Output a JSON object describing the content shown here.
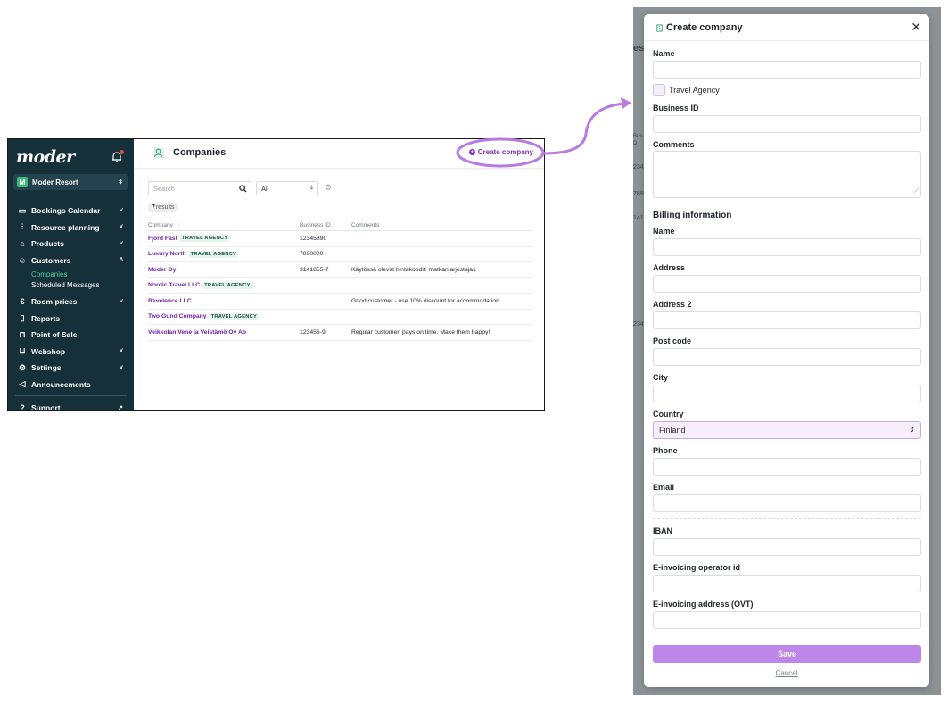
{
  "app": {
    "logo": "moder",
    "resort": {
      "initial": "M",
      "name": "Moder Resort"
    },
    "nav": [
      {
        "label": "Bookings Calendar",
        "icon": "calendar-icon",
        "chevron": "˅"
      },
      {
        "label": "Resource planning",
        "icon": "sliders-icon",
        "chevron": "˅"
      },
      {
        "label": "Products",
        "icon": "home-icon",
        "chevron": "˅"
      },
      {
        "label": "Customers",
        "icon": "users-icon",
        "chevron": "˄"
      },
      {
        "label": "Room prices",
        "icon": "euro-icon",
        "chevron": "˅"
      },
      {
        "label": "Reports",
        "icon": "report-icon",
        "chevron": ""
      },
      {
        "label": "Point of Sale",
        "icon": "bag-icon",
        "chevron": ""
      },
      {
        "label": "Webshop",
        "icon": "cart-icon",
        "chevron": "˅"
      },
      {
        "label": "Settings",
        "icon": "gear-icon",
        "chevron": "˅"
      },
      {
        "label": "Announcements",
        "icon": "megaphone-icon",
        "chevron": ""
      },
      {
        "label": "Support",
        "icon": "help-icon",
        "chevron": ""
      }
    ],
    "customers_sub": [
      "Companies",
      "Scheduled Messages"
    ],
    "page_title": "Companies",
    "create_label": "Create company",
    "search_placeholder": "Search",
    "filter_value": "All",
    "results_count": "7",
    "results_label": "results",
    "table": {
      "headers": [
        "Company",
        "Business ID",
        "Comments"
      ],
      "sort_indicator": "↑↓",
      "rows": [
        {
          "name": "Fjord Fast",
          "tag": "TRAVEL AGENCY",
          "business_id": "12345890",
          "comment": ""
        },
        {
          "name": "Luxury North",
          "tag": "TRAVEL AGENCY",
          "business_id": "7890000",
          "comment": ""
        },
        {
          "name": "Moder Oy",
          "tag": "",
          "business_id": "3141855-7",
          "comment": "Käytössä olevat hintakoodit: matkanjarjestaja1"
        },
        {
          "name": "Nordic Travel LLC",
          "tag": "TRAVEL AGENCY",
          "business_id": "",
          "comment": ""
        },
        {
          "name": "Revelence LLC",
          "tag": "",
          "business_id": "",
          "comment": "Good customer - use 10% discount for accommodation"
        },
        {
          "name": "Two Gund Company",
          "tag": "TRAVEL AGENCY",
          "business_id": "",
          "comment": ""
        },
        {
          "name": "Veikkolan Vene ja Veistämö Oy Ab",
          "tag": "",
          "business_id": "123456-9",
          "comment": "Regular customer, pays on time. Make them happy!"
        }
      ]
    }
  },
  "modal": {
    "title": "Create company",
    "name_label": "Name",
    "travel_agency_label": "Travel Agency",
    "business_id_label": "Business ID",
    "comments_label": "Comments",
    "billing_section": "Billing information",
    "billing_name_label": "Name",
    "address_label": "Address",
    "address2_label": "Address 2",
    "postcode_label": "Post code",
    "city_label": "City",
    "country_label": "Country",
    "country_value": "Finland",
    "phone_label": "Phone",
    "email_label": "Email",
    "iban_label": "IBAN",
    "operator_label": "E-invoicing operator id",
    "ovt_label": "E-invoicing address (OVT)",
    "save_label": "Save",
    "cancel_label": "Cancel"
  },
  "backdrop_fragments": [
    "es",
    "Bus",
    "D",
    "234",
    "789",
    "141",
    "234"
  ],
  "colors": {
    "sidebar": "#16303a",
    "accent": "#7a2fb8",
    "save": "#bd86e8",
    "arrow": "#b77be3",
    "tag_bg": "#e6f4ee"
  }
}
